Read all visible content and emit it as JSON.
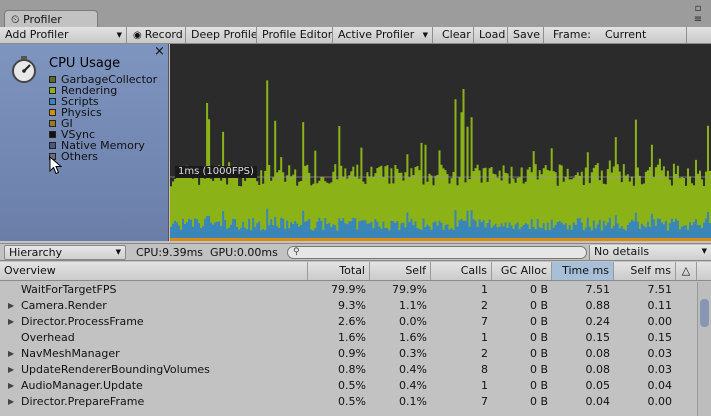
{
  "window": {
    "tab_title": "Profiler",
    "menu_icon": "≡"
  },
  "toolbar": {
    "add_profiler": "Add Profiler",
    "record": "Record",
    "deep_profile": "Deep Profile",
    "profile_editor": "Profile Editor",
    "active_profiler": "Active Profiler",
    "clear": "Clear",
    "load": "Load",
    "save": "Save",
    "frame_label": "Frame:",
    "frame_value": "Current"
  },
  "legend": {
    "title": "CPU Usage",
    "close": "×",
    "items": [
      {
        "label": "GarbageCollector",
        "color": "#5a6a24"
      },
      {
        "label": "Rendering",
        "color": "#8bb318"
      },
      {
        "label": "Scripts",
        "color": "#3a86b8"
      },
      {
        "label": "Physics",
        "color": "#d98a10"
      },
      {
        "label": "GI",
        "color": "#9a7a1a"
      },
      {
        "label": "VSync",
        "color": "#111111"
      },
      {
        "label": "Native Memory",
        "color": "#4a5a7a"
      },
      {
        "label": "Others",
        "color": "#6a6e79"
      }
    ]
  },
  "graph": {
    "fps_label": "1ms (1000FPS)"
  },
  "hierarchy_bar": {
    "mode": "Hierarchy",
    "cpu": "CPU:9.39ms",
    "gpu": "GPU:0.00ms",
    "search_icon": "⚲",
    "details": "No details"
  },
  "columns": {
    "overview": "Overview",
    "total": "Total",
    "self": "Self",
    "calls": "Calls",
    "gc_alloc": "GC Alloc",
    "time_ms": "Time ms",
    "self_ms": "Self ms",
    "warn_icon": "△"
  },
  "rows": [
    {
      "name": "WaitForTargetFPS",
      "expandable": false,
      "total": "79.9%",
      "self": "79.9%",
      "calls": "1",
      "gc": "0 B",
      "time": "7.51",
      "selfms": "7.51"
    },
    {
      "name": "Camera.Render",
      "expandable": true,
      "total": "9.3%",
      "self": "1.1%",
      "calls": "2",
      "gc": "0 B",
      "time": "0.88",
      "selfms": "0.11"
    },
    {
      "name": "Director.ProcessFrame",
      "expandable": true,
      "total": "2.6%",
      "self": "0.0%",
      "calls": "7",
      "gc": "0 B",
      "time": "0.24",
      "selfms": "0.00"
    },
    {
      "name": "Overhead",
      "expandable": false,
      "total": "1.6%",
      "self": "1.6%",
      "calls": "1",
      "gc": "0 B",
      "time": "0.15",
      "selfms": "0.15"
    },
    {
      "name": "NavMeshManager",
      "expandable": true,
      "total": "0.9%",
      "self": "0.3%",
      "calls": "2",
      "gc": "0 B",
      "time": "0.08",
      "selfms": "0.03"
    },
    {
      "name": "UpdateRendererBoundingVolumes",
      "expandable": true,
      "total": "0.8%",
      "self": "0.4%",
      "calls": "8",
      "gc": "0 B",
      "time": "0.08",
      "selfms": "0.03"
    },
    {
      "name": "AudioManager.Update",
      "expandable": true,
      "total": "0.5%",
      "self": "0.4%",
      "calls": "1",
      "gc": "0 B",
      "time": "0.05",
      "selfms": "0.04"
    },
    {
      "name": "Director.PrepareFrame",
      "expandable": true,
      "total": "0.5%",
      "self": "0.1%",
      "calls": "7",
      "gc": "0 B",
      "time": "0.04",
      "selfms": "0.00"
    }
  ]
}
